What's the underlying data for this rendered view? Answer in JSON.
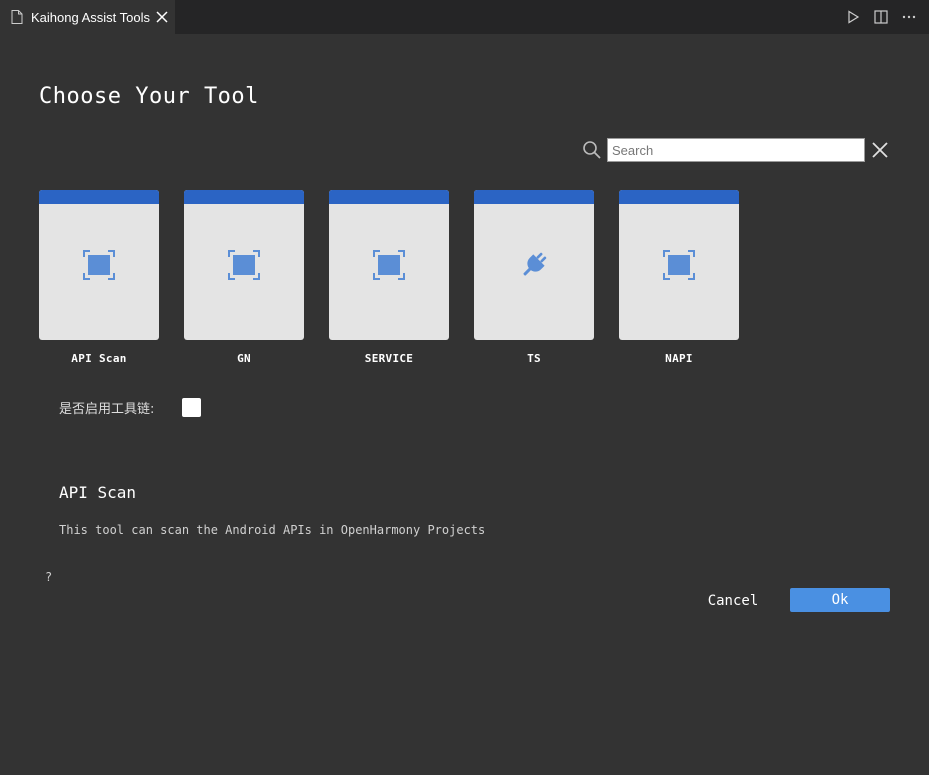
{
  "tab": {
    "title": "Kaihong Assist Tools",
    "icon": "file-icon",
    "close_icon": "close-icon"
  },
  "toolbar_actions": [
    "run-icon",
    "split-editor-icon",
    "more-icon"
  ],
  "page": {
    "title": "Choose Your Tool"
  },
  "search": {
    "placeholder": "Search",
    "value": ""
  },
  "tools": [
    {
      "label": "API Scan",
      "icon": "scan-icon"
    },
    {
      "label": "GN",
      "icon": "scan-icon"
    },
    {
      "label": "SERVICE",
      "icon": "scan-icon"
    },
    {
      "label": "TS",
      "icon": "plug-icon"
    },
    {
      "label": "NAPI",
      "icon": "scan-icon"
    }
  ],
  "toolchain": {
    "label": "是否启用工具链:",
    "checked": false
  },
  "description": {
    "title": "API Scan",
    "text": "This tool can scan the Android APIs in OpenHarmony Projects"
  },
  "help": {
    "label": "?"
  },
  "buttons": {
    "cancel": "Cancel",
    "ok": "Ok"
  },
  "colors": {
    "background": "#333333",
    "tabbar": "#252526",
    "card_header": "#2b64c4",
    "card_body": "#e4e4e4",
    "icon": "#5b8ed6",
    "ok_button": "#4a90e2"
  }
}
